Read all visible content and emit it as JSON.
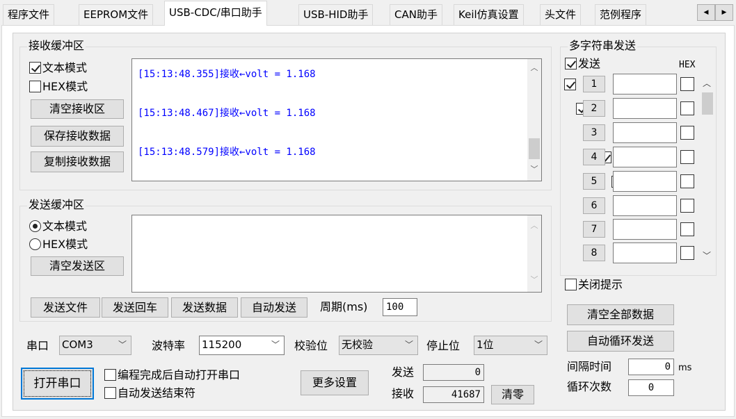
{
  "tabs": [
    "程序文件",
    "EEPROM文件",
    "USB-CDC/串口助手",
    "USB-HID助手",
    "CAN助手",
    "Keil仿真设置",
    "头文件",
    "范例程序"
  ],
  "tab_scroll": {
    "left": "◀",
    "right": "▶"
  },
  "receive": {
    "title": "接收缓冲区",
    "text_mode": "文本模式",
    "hex_mode": "HEX模式",
    "clear_btn": "清空接收区",
    "save_btn": "保存接收数据",
    "copy_btn": "复制接收数据",
    "lines": [
      "[15:13:48.355]接收←volt = 1.168",
      "[15:13:48.467]接收←volt = 1.168",
      "[15:13:48.579]接收←volt = 1.168"
    ]
  },
  "send": {
    "title": "发送缓冲区",
    "text_mode": "文本模式",
    "hex_mode": "HEX模式",
    "clear_btn": "清空发送区",
    "send_file": "发送文件",
    "send_enter": "发送回车",
    "send_data": "发送数据",
    "auto_send": "自动发送",
    "period_label": "周期(ms)",
    "period_value": "100"
  },
  "port": {
    "port_label": "串口",
    "port_value": "COM3",
    "baud_label": "波特率",
    "baud_value": "115200",
    "parity_label": "校验位",
    "parity_value": "无校验",
    "stop_label": "停止位",
    "stop_value": "1位",
    "open_btn": "打开串口",
    "auto_open": "编程完成后自动打开串口",
    "auto_end": "自动发送结束符",
    "more_btn": "更多设置",
    "sent_label": "发送",
    "sent_value": "0",
    "recv_label": "接收",
    "recv_value": "41687",
    "clear_btn": "清零"
  },
  "multi": {
    "title": "多字符串发送",
    "send_label": "发送",
    "hex_label": "HEX",
    "rows": [
      "1",
      "2",
      "3",
      "4",
      "5",
      "6",
      "7",
      "8"
    ],
    "close_tip": "关闭提示",
    "clear_all": "清空全部数据",
    "auto_loop": "自动循环发送",
    "interval_label": "间隔时间",
    "interval_value": "0",
    "interval_unit": "ms",
    "loop_label": "循环次数",
    "loop_value": "0"
  }
}
